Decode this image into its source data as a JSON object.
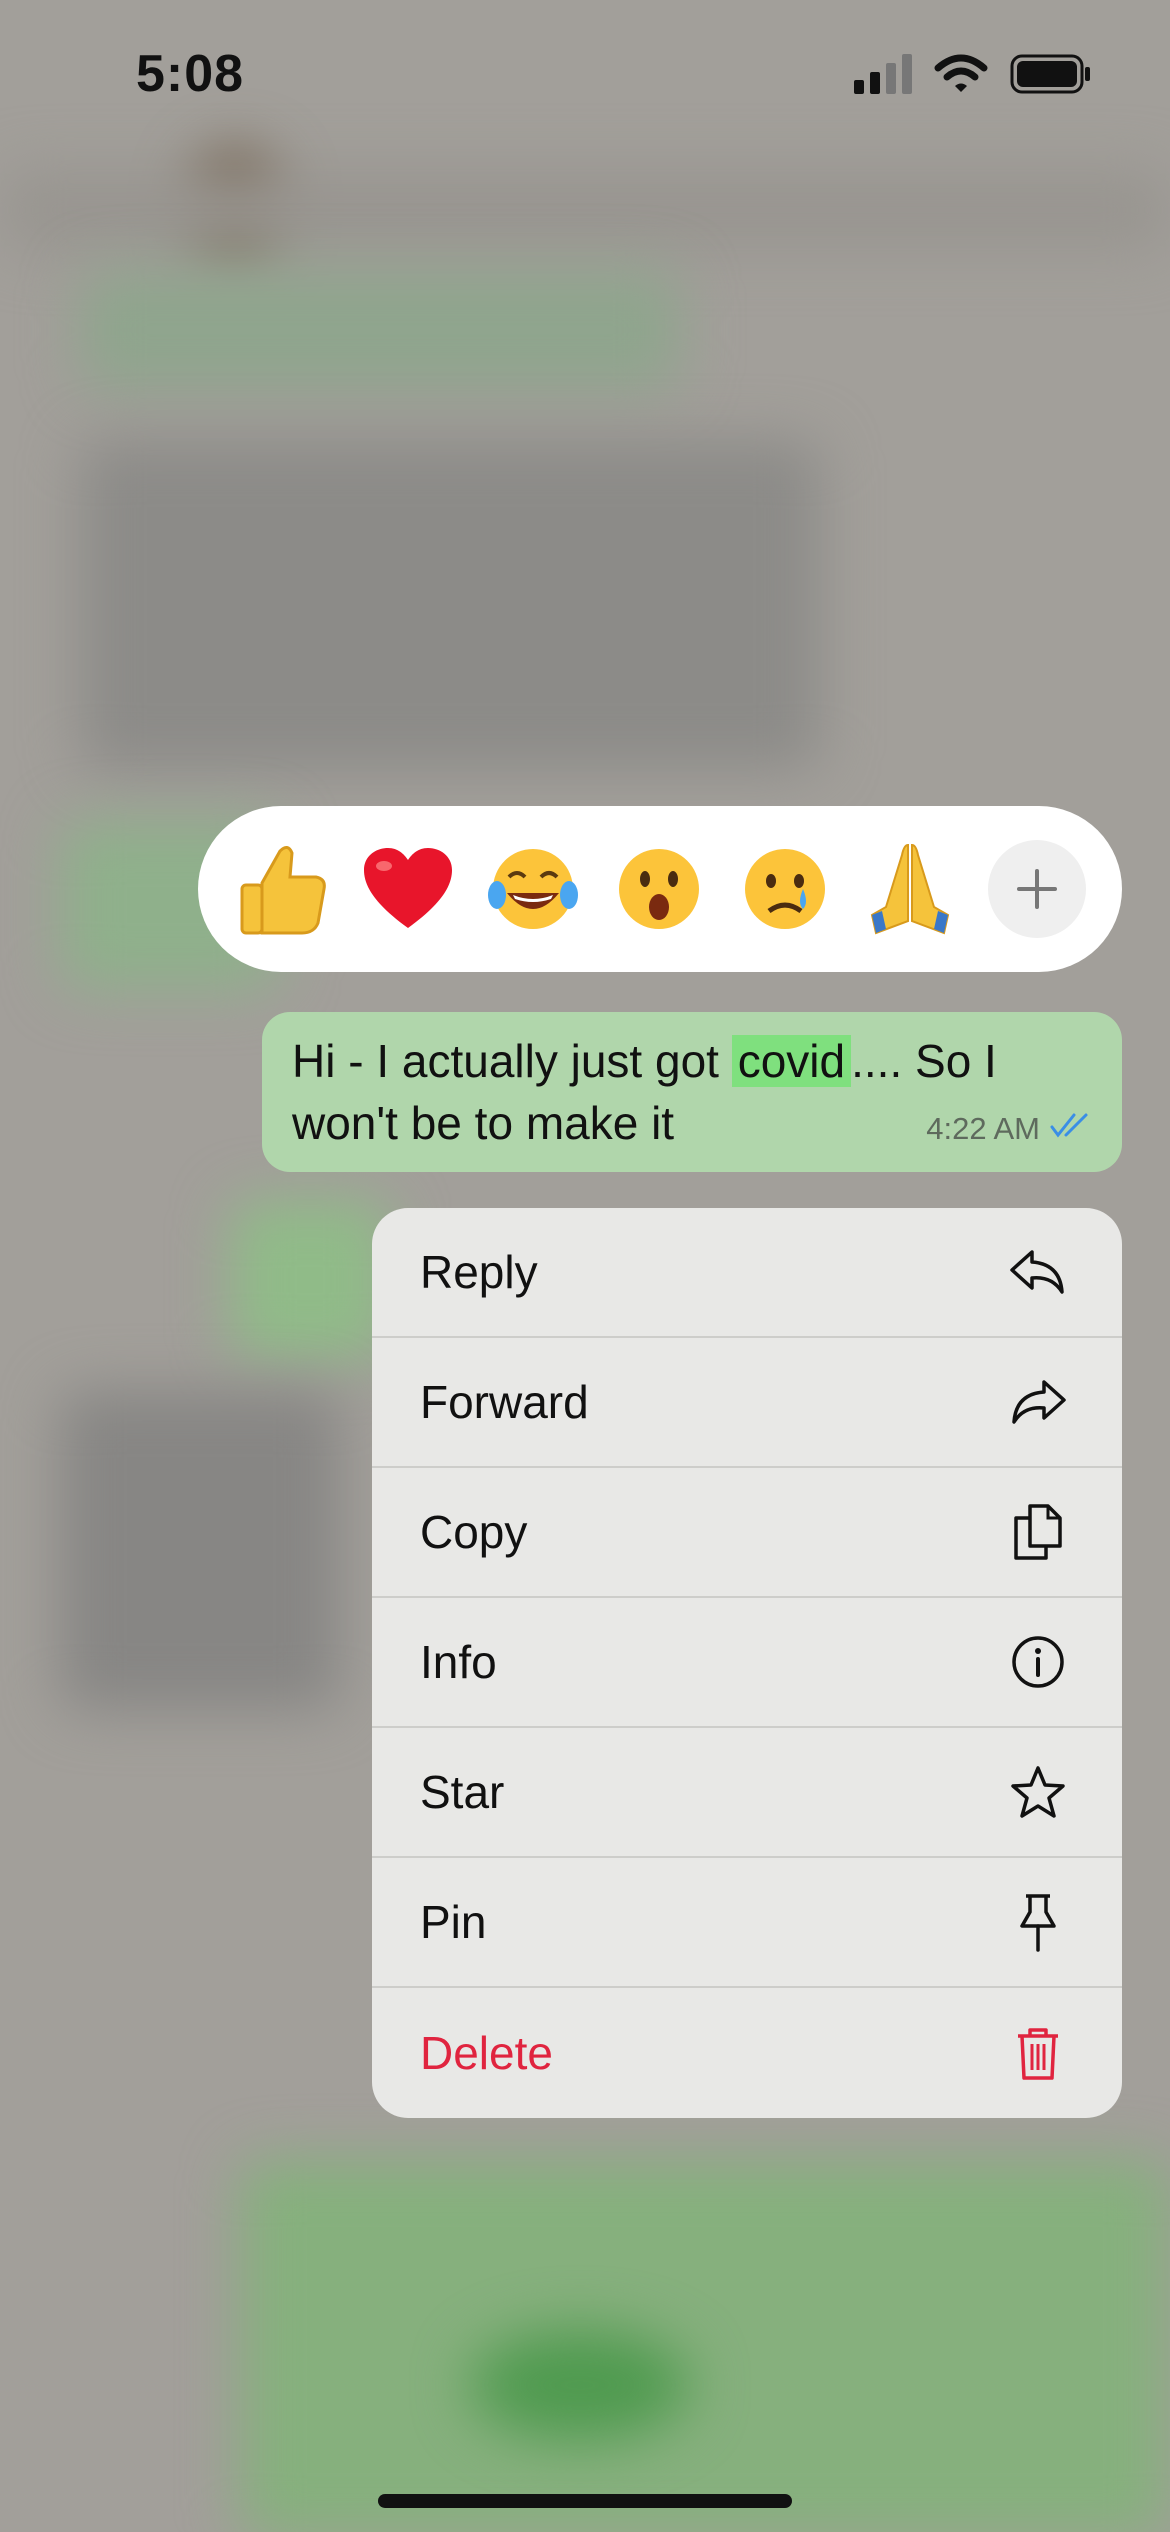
{
  "status_bar": {
    "time": "5:08"
  },
  "reactions": [
    {
      "name": "thumbs-up",
      "glyph": "👍"
    },
    {
      "name": "red-heart",
      "glyph": "❤️"
    },
    {
      "name": "tears-of-joy",
      "glyph": "😂"
    },
    {
      "name": "surprised",
      "glyph": "😮"
    },
    {
      "name": "crying",
      "glyph": "😢"
    },
    {
      "name": "folded-hands",
      "glyph": "🙏"
    }
  ],
  "message": {
    "text_before": "Hi - I actually just got ",
    "highlight": "covid",
    "text_after": ".... So I won't be to make it",
    "time": "4:22 AM",
    "read_status": "read"
  },
  "menu": {
    "items": [
      {
        "label": "Reply",
        "icon": "reply-icon"
      },
      {
        "label": "Forward",
        "icon": "forward-icon"
      },
      {
        "label": "Copy",
        "icon": "copy-icon"
      },
      {
        "label": "Info",
        "icon": "info-icon"
      },
      {
        "label": "Star",
        "icon": "star-icon"
      },
      {
        "label": "Pin",
        "icon": "pin-icon"
      },
      {
        "label": "Delete",
        "icon": "trash-icon",
        "destructive": true
      }
    ]
  },
  "colors": {
    "bubble": "#b0d6ab",
    "highlight": "#7fe07e",
    "delete": "#e0243f",
    "read_ticks": "#3a8ee6"
  }
}
